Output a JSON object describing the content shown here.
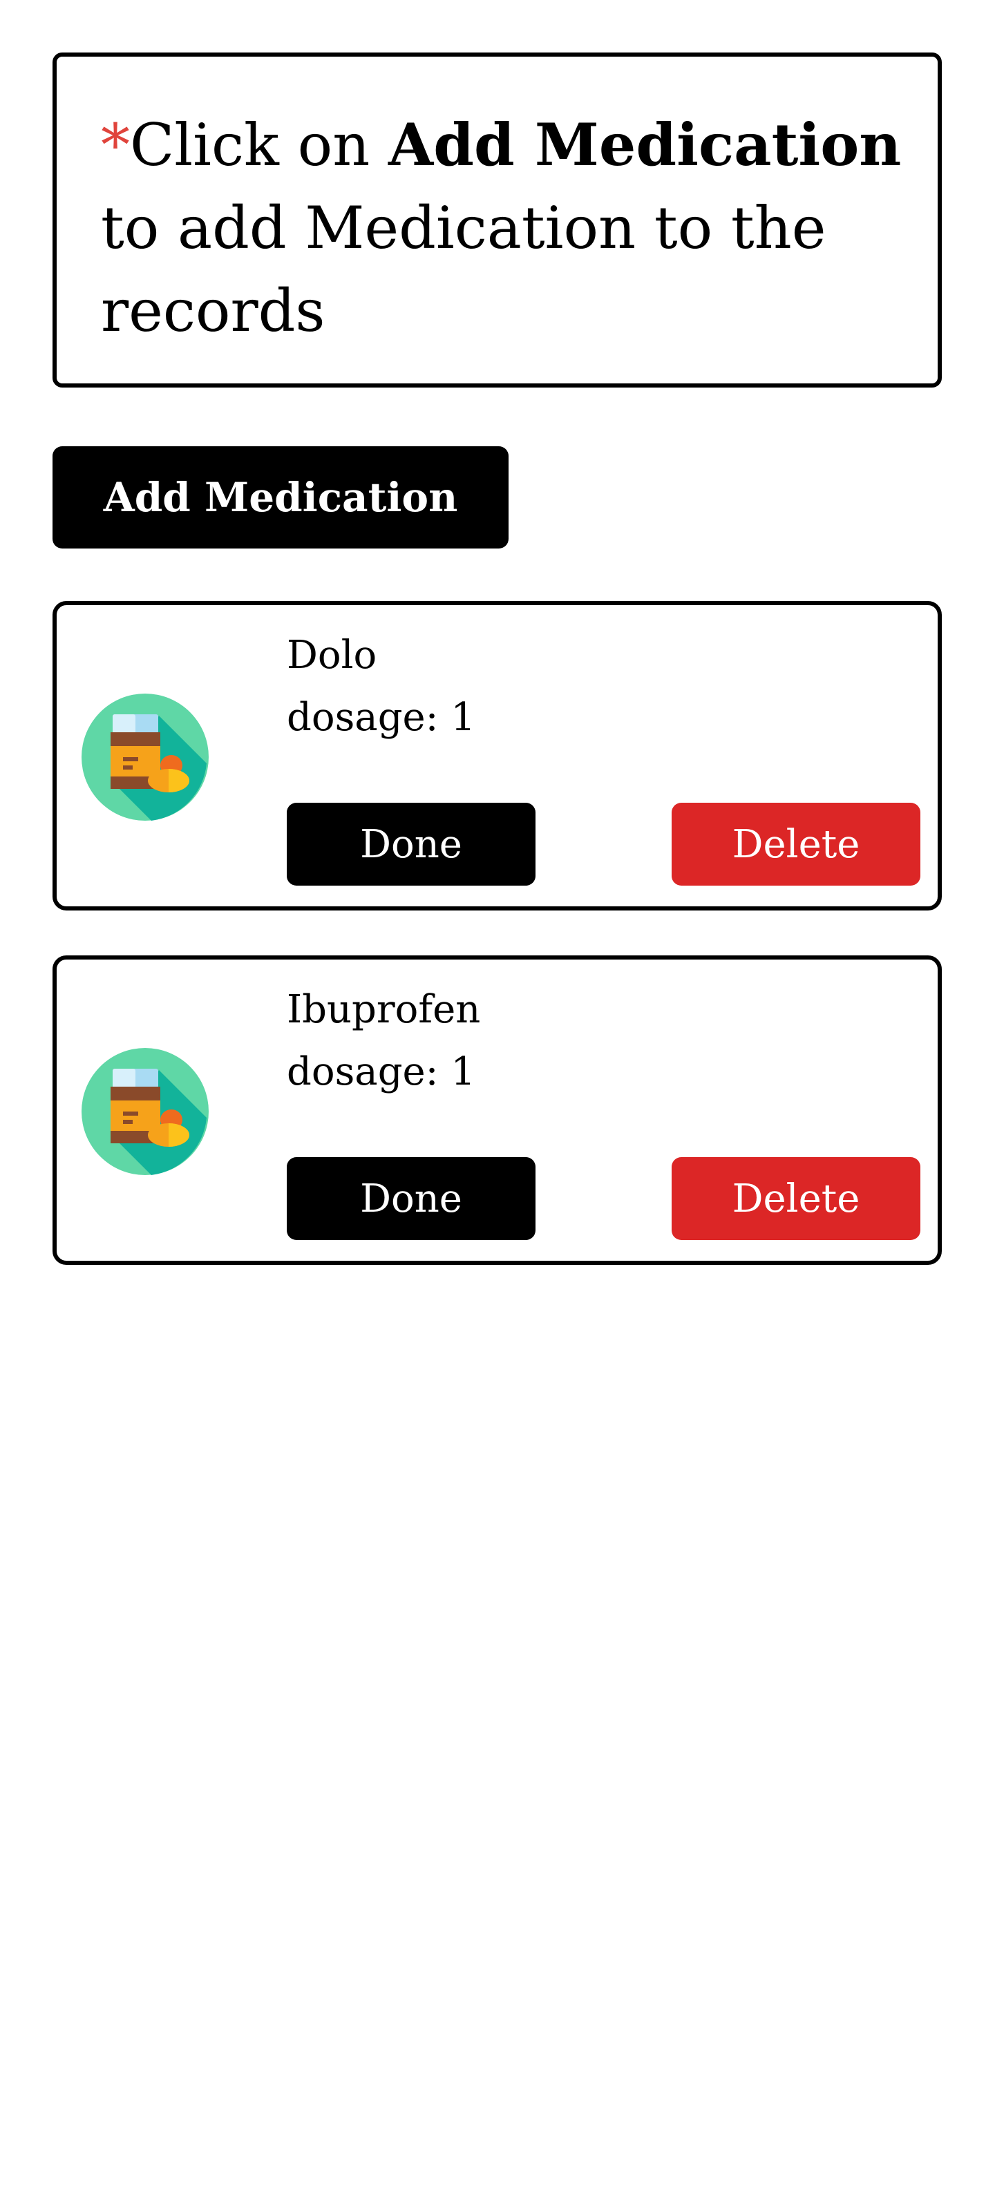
{
  "instruction": {
    "required_mark": "*",
    "prefix": "Click on ",
    "emphasis": "Add Medication",
    "suffix": " to add Medication to the records"
  },
  "add_button_label": "Add Medication",
  "medications": [
    {
      "name": "Dolo",
      "dosage_label": "dosage: 1",
      "done_label": "Done",
      "delete_label": "Delete",
      "icon": "medicine-bottle-icon"
    },
    {
      "name": "Ibuprofen",
      "dosage_label": "dosage: 1",
      "done_label": "Done",
      "delete_label": "Delete",
      "icon": "medicine-bottle-icon"
    }
  ],
  "colors": {
    "accent": "#000000",
    "danger": "#dc2626",
    "required": "#e0443c",
    "icon_circle": "#5fd7a6",
    "icon_shadow": "#12b39a"
  }
}
